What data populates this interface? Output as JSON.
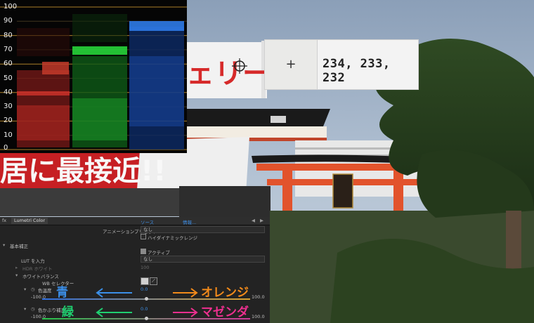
{
  "scope": {
    "ticks": [
      "100",
      "80",
      "60",
      "40",
      "20",
      "0"
    ],
    "tick_90": "90",
    "tick_70": "70",
    "tick_50": "50",
    "tick_30": "30",
    "tick_10": "10"
  },
  "readout": {
    "cursor": "+",
    "rgb": "234, 233, 232"
  },
  "photo": {
    "sign_text": "ェリー",
    "banner_text": "居に最接近!!"
  },
  "panel": {
    "tab": "Lumetri Color",
    "fx_label": "fx",
    "header_source": "ソース",
    "header_source_value": "情報...",
    "anim_preset_label": "アニメーションプリセット",
    "anim_preset_value": "なし",
    "high_dynamic": "ハイダイナミックレンジ",
    "basic_section": "基本補正",
    "active_label": "アクティブ",
    "lut_label": "LUT を入力",
    "lut_value": "なし",
    "hdr_label": "HDR ホワイト",
    "hdr_value": "100",
    "wb_section": "ホワイトバランス",
    "wb_selector": "WB セレクター",
    "temp_label": "色温度",
    "temp_value": "0.0",
    "temp_min": "-100.0",
    "temp_max": "100.0",
    "tint_label": "色かぶり補正",
    "tint_value": "0.0",
    "tint_min": "-100.0",
    "tint_max": "100.0"
  },
  "annotations": {
    "blue": "青",
    "orange": "オレンジ",
    "green": "緑",
    "magenta": "マゼンダ"
  },
  "colors": {
    "blue_ann": "#3b8fe8",
    "orange_ann": "#f28a1a",
    "green_ann": "#1fd070",
    "magenta_ann": "#ee2f8f",
    "scope_red": "#d8342e",
    "scope_green": "#27d43a",
    "scope_blue": "#2f7be8",
    "gridline": "#d9a33a"
  }
}
